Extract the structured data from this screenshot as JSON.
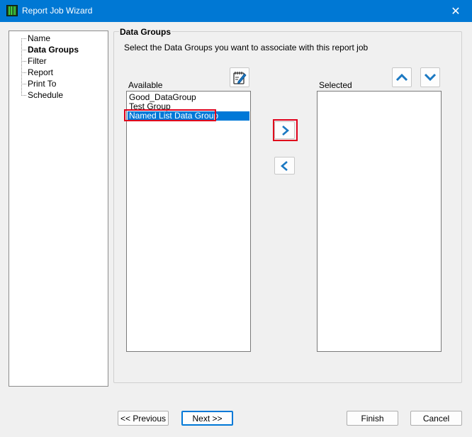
{
  "window": {
    "title": "Report Job Wizard",
    "close_symbol": "✕"
  },
  "nav": {
    "items": [
      {
        "label": "Name",
        "active": false
      },
      {
        "label": "Data Groups",
        "active": true
      },
      {
        "label": "Filter",
        "active": false
      },
      {
        "label": "Report",
        "active": false
      },
      {
        "label": "Print To",
        "active": false
      },
      {
        "label": "Schedule",
        "active": false
      }
    ]
  },
  "section": {
    "title": "Data Groups",
    "instruction": "Select the Data Groups you want to associate with this report job"
  },
  "available": {
    "label": "Available",
    "items": [
      {
        "label": "Good_DataGroup",
        "selected": false
      },
      {
        "label": "Test Group",
        "selected": false
      },
      {
        "label": "Named List Data Group",
        "selected": true
      }
    ]
  },
  "selected": {
    "label": "Selected",
    "items": []
  },
  "icons": {
    "edit": "edit-note-icon",
    "add": "chevron-right-icon",
    "remove": "chevron-left-icon",
    "up": "chevron-up-icon",
    "down": "chevron-down-icon",
    "accent": "#1a78c2"
  },
  "buttons": {
    "previous": "<< Previous",
    "next": "Next >>",
    "finish": "Finish",
    "cancel": "Cancel"
  }
}
